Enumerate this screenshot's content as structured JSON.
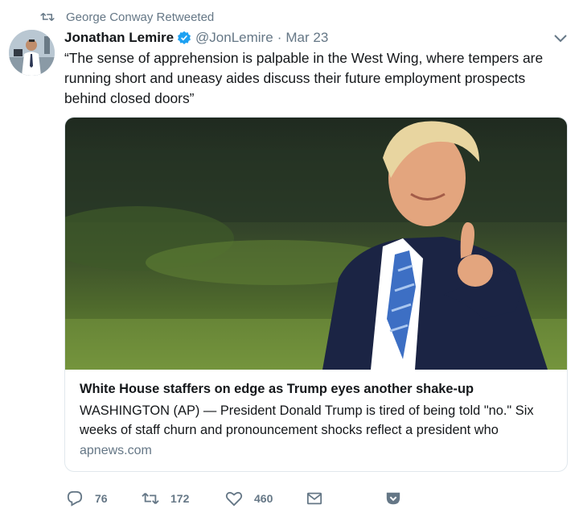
{
  "retweet_header": {
    "text": "George Conway Retweeted"
  },
  "tweet": {
    "author_name": "Jonathan Lemire",
    "author_handle": "@JonLemire",
    "separator": "·",
    "timestamp": "Mar 23",
    "text": "“The sense of apprehension is palpable in the West Wing, where tempers are running short and uneasy aides discuss their future employment prospects behind closed doors”"
  },
  "card": {
    "title": "White House staffers on edge as Trump eyes another shake-up",
    "description": "WASHINGTON (AP) — President Donald Trump is tired of being told \"no.\" Six weeks of staff churn and pronouncement shocks reflect a president who",
    "domain": "apnews.com"
  },
  "actions": {
    "reply_count": "76",
    "retweet_count": "172",
    "like_count": "460"
  },
  "colors": {
    "text": "#14171a",
    "muted": "#657786",
    "verified": "#1da1f2",
    "border": "#e1e8ed"
  }
}
